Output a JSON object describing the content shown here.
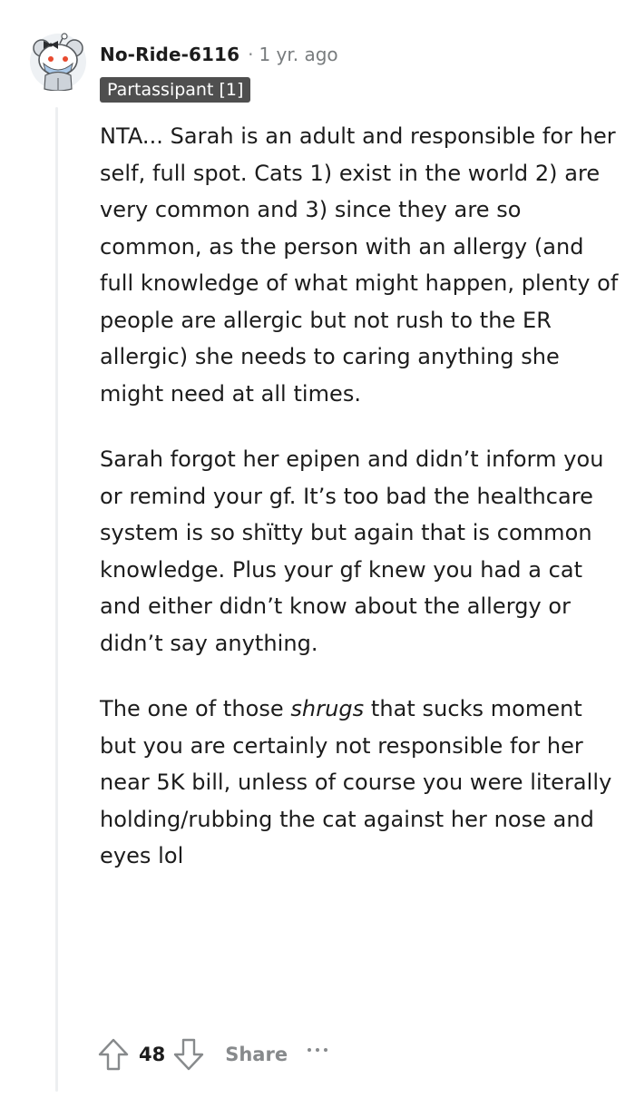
{
  "comment": {
    "author": "No-Ride-6116",
    "separator": "·",
    "timestamp": "1 yr. ago",
    "flair": "Partassipant [1]",
    "avatar_icon": "snoo-avatar-icon",
    "paragraphs": [
      {
        "text": "NTA... Sarah is an adult and responsible for her self, full spot. Cats 1) exist in the world 2) are very common and 3) since they are so common, as the person with an allergy (and full knowledge of what might happen, plenty of people are allergic but not rush to the ER allergic) she needs to caring anything she might need at all times."
      },
      {
        "text": "Sarah forgot her epipen and didn’t inform you or remind your gf. It’s too bad the healthcare system is so shïtty but again that is common knowledge. Plus your gf knew you had a cat and either didn’t know about the allergy or didn’t say anything."
      },
      {
        "before": "The one of those ",
        "emphasis": "shrugs",
        "after": " that sucks moment but you are certainly not responsible for her near 5K bill, unless of course you were literally holding/rubbing the cat against her nose and eyes lol"
      }
    ],
    "actions": {
      "upvote_icon": "upvote-arrow-icon",
      "score": "48",
      "downvote_icon": "downvote-arrow-icon",
      "share_label": "Share",
      "more_icon": "more-options-icon"
    }
  },
  "colors": {
    "text": "#1c1c1c",
    "meta": "#787c7e",
    "flair_bg": "#4f4f4f",
    "flair_text": "#ffffff",
    "thread_line": "#edeff1",
    "icon": "#878a8c"
  }
}
